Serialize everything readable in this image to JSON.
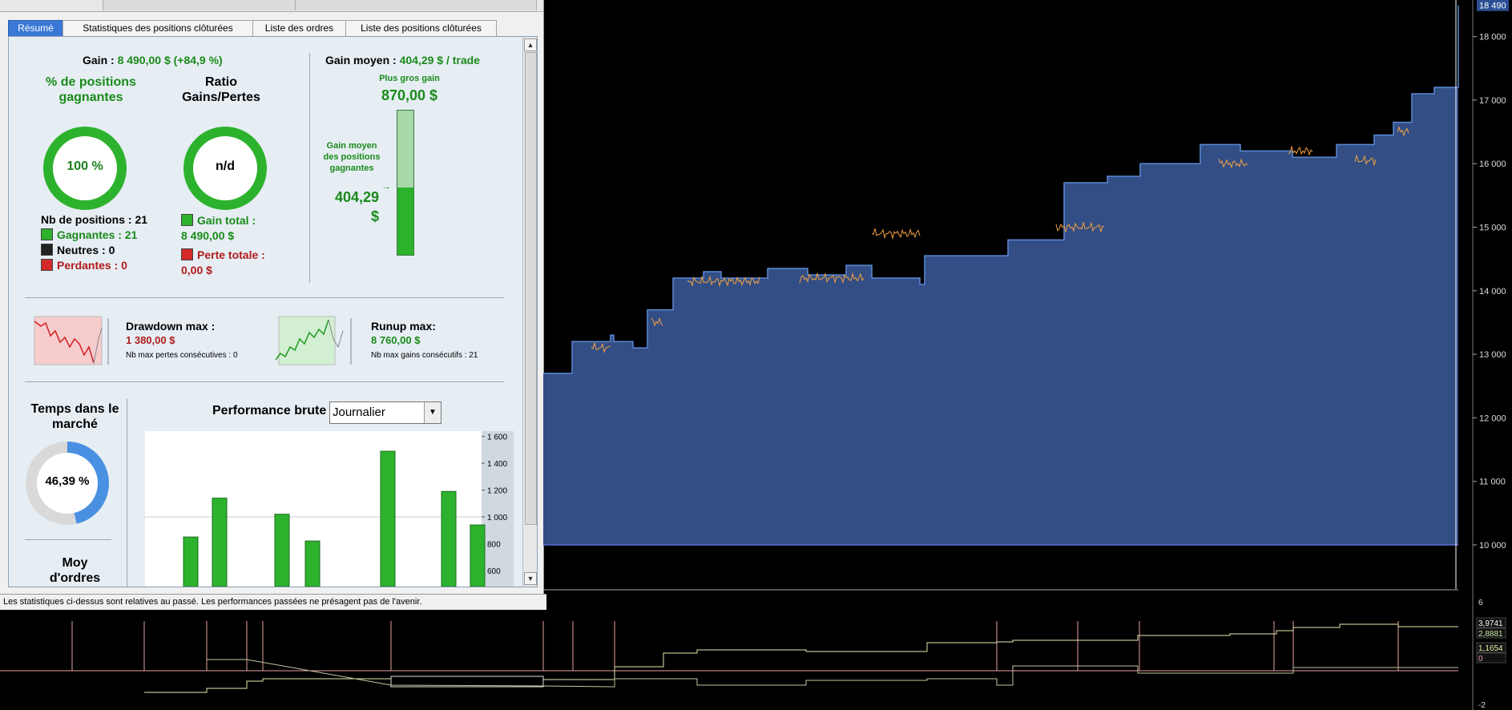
{
  "tabs": [
    "Résumé",
    "Statistiques des positions clôturées",
    "Liste des ordres",
    "Liste des positions clôturées"
  ],
  "gain": {
    "label": "Gain :",
    "value": "8 490,00 $ (+84,9 %)"
  },
  "gain_moyen": {
    "label": "Gain moyen :",
    "value": "404,29 $ / trade"
  },
  "winpct": {
    "title": "% de positions gagnantes",
    "value": "100 %",
    "fraction": 1.0
  },
  "ratio": {
    "title": "Ratio Gains/Pertes",
    "value": "n/d"
  },
  "positions": {
    "total_label": "Nb de positions : 21",
    "gagnantes": "Gagnantes : 21",
    "neutres": "Neutres : 0",
    "perdantes": "Perdantes : 0"
  },
  "totals": {
    "gain_total_label": "Gain total :",
    "gain_total_value": "8 490,00 $",
    "perte_totale_label": "Perte totale :",
    "perte_totale_value": "0,00 $"
  },
  "bar_gauge": {
    "top_label": "Plus gros gain",
    "top_value": "870,00 $",
    "mid_label": "Gain moyen des positions gagnantes",
    "mid_value": "404,29 $",
    "fill_fraction": 0.465
  },
  "drawdown": {
    "label": "Drawdown max :",
    "value": "1 380,00 $",
    "sub": "Nb max pertes consécutives : 0"
  },
  "runup": {
    "label": "Runup max:",
    "value": "8 760,00 $",
    "sub": "Nb max gains consécutifs : 21"
  },
  "temps_marche": {
    "title": "Temps dans le marché",
    "value": "46,39 %",
    "fraction": 0.4639
  },
  "moy_ordres": {
    "title": "Moy d'ordres"
  },
  "perf": {
    "title": "Performance brute",
    "period": "Journalier",
    "yticks": [
      "1 600",
      "1 400",
      "1 200",
      "1 000",
      "800",
      "600"
    ],
    "bars": [
      850,
      1140,
      1020,
      820,
      1490,
      1190,
      940
    ]
  },
  "status_text": "Les statistiques ci-dessus sont relatives au passé. Les performances passées ne présagent pas de l'avenir.",
  "main_chart": {
    "yticks": [
      "18 000",
      "17 000",
      "16 000",
      "15 000",
      "14 000",
      "13 000",
      "12 000",
      "11 000",
      "10 000"
    ],
    "last_value": "18 490",
    "fill_color": "#334e85",
    "line_color": "#5b8ad6",
    "price_color": "#f0a040"
  },
  "sub_chart": {
    "ticks": [
      "6",
      "-2"
    ],
    "badges": [
      "3,9741",
      "2,8881",
      "1,1654",
      "0"
    ]
  }
}
